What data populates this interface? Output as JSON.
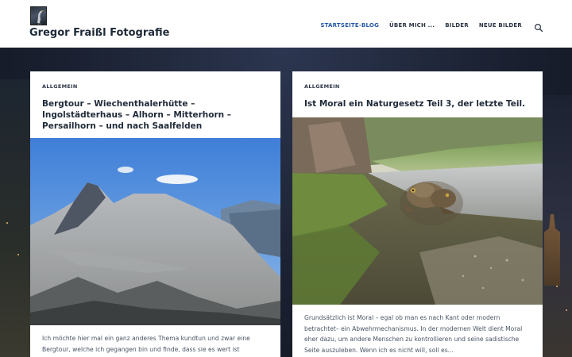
{
  "header": {
    "site_title": "Gregor Fraißl Fotografie",
    "logo_icon": "heron-logo-icon",
    "nav": [
      {
        "label": "STARTSEITE-BLOG",
        "active": true
      },
      {
        "label": "ÜBER MICH ...",
        "active": false
      },
      {
        "label": "BILDER",
        "active": false
      },
      {
        "label": "NEUE BILDER",
        "active": false
      }
    ],
    "search_icon": "search-icon"
  },
  "posts": [
    {
      "category": "ALLGEMEIN",
      "title": "Bergtour – Wiechenthalerhütte – Ingolstädterhaus – Alhorn – Mitterhorn – Persailhorn – und nach Saalfelden",
      "image": "mountain-landscape-photo",
      "excerpt": "Ich möchte hier mal ein ganz anderes Thema kundtun und zwar eine Bergtour, welche ich gegangen bin und finde, dass sie es wert ist"
    },
    {
      "category": "ALLGEMEIN",
      "title": "Ist Moral ein Naturgesetz Teil 3, der letzte Teil.",
      "image": "toads-on-road-photo",
      "excerpt": "Grundsätzlich ist Moral – egal ob man es nach Kant oder modern betrachtet– ein Abwehrmechanismus. In der modernen Welt dient Moral eher dazu, um andere Menschen zu kontrollieren und seine sadistische Seite auszuleben. Wenn ich es nicht will, soll es..."
    }
  ],
  "colors": {
    "header_bg": "#ffffff",
    "title": "#1f2a38",
    "nav_active": "#2458a7",
    "page_bg": "#1b2232"
  }
}
